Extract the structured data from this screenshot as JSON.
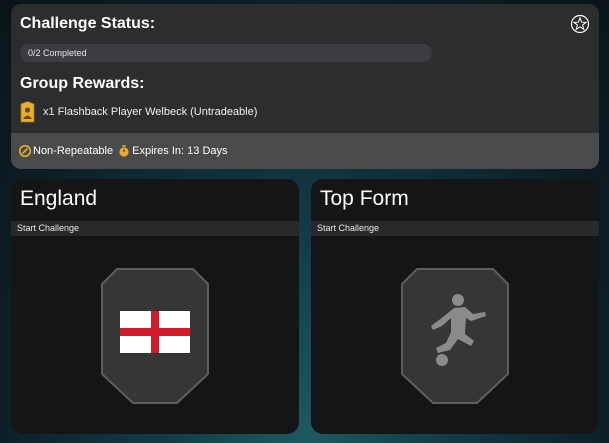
{
  "status": {
    "title": "Challenge Status:",
    "progress_text": "0/2 Completed",
    "progress_fraction": 0
  },
  "rewards": {
    "title": "Group Rewards:",
    "items": [
      {
        "icon": "player-card-icon",
        "text": "x1 Flashback Player Welbeck (Untradeable)"
      }
    ]
  },
  "footer": {
    "repeat_label": "Non-Repeatable",
    "expires_label": "Expires In: 13 Days"
  },
  "challenges": [
    {
      "title": "England",
      "action": "Start Challenge",
      "icon": "england-flag-icon"
    },
    {
      "title": "Top Form",
      "action": "Start Challenge",
      "icon": "footballer-kick-icon"
    }
  ],
  "colors": {
    "accent_gold": "#e8b028",
    "panel_bg": "#2b2d2f",
    "card_bg": "#141516",
    "flag_red": "#d01c2c"
  }
}
